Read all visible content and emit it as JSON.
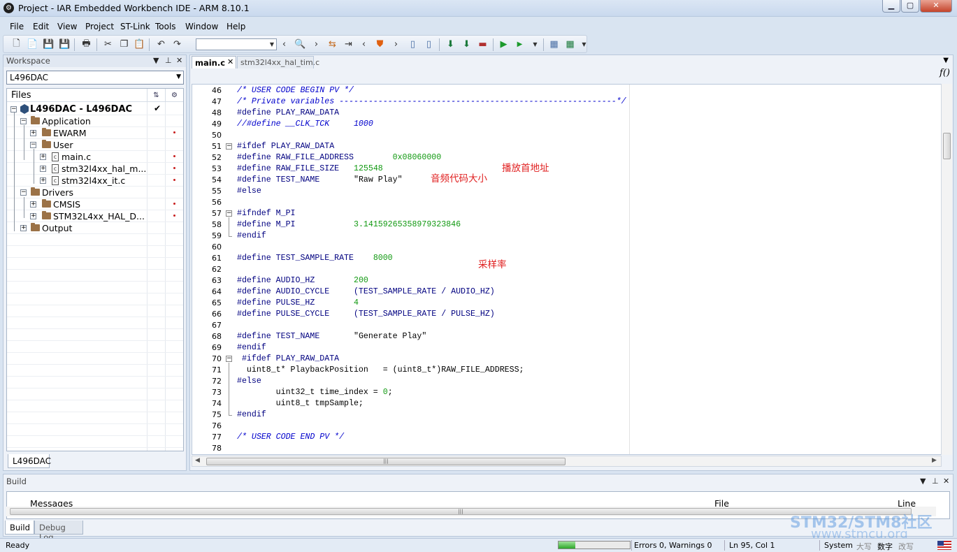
{
  "window": {
    "title": "Project - IAR Embedded Workbench IDE - ARM 8.10.1",
    "min": "▁",
    "max": "▢",
    "close": "✕"
  },
  "menu": [
    "File",
    "Edit",
    "View",
    "Project",
    "ST-Link",
    "Tools",
    "Window",
    "Help"
  ],
  "workspace": {
    "title": "Workspace",
    "config": "L496DAC",
    "files_header": "Files",
    "tab": "L496DAC",
    "tree": [
      {
        "label": "L496DAC - L496DAC",
        "bold": true,
        "check": "✔"
      },
      {
        "label": "Application"
      },
      {
        "label": "EWARM"
      },
      {
        "label": "User"
      },
      {
        "label": "main.c"
      },
      {
        "label": "stm32l4xx_hal_m..."
      },
      {
        "label": "stm32l4xx_it.c"
      },
      {
        "label": "Drivers"
      },
      {
        "label": "CMSIS"
      },
      {
        "label": "STM32L4xx_HAL_D..."
      },
      {
        "label": "Output"
      }
    ]
  },
  "editor": {
    "tabs": [
      {
        "label": "main.c",
        "active": true,
        "close": "✕"
      },
      {
        "label": "stm32l4xx_hal_tim.c",
        "active": false
      }
    ],
    "fn_label": "f()",
    "lines": [
      {
        "n": "46",
        "parts": [
          {
            "t": "/* USER CODE BEGIN PV */",
            "c": "com"
          }
        ]
      },
      {
        "n": "47",
        "parts": [
          {
            "t": "/* Private variables ---------------------------------------------------------*/",
            "c": "com"
          }
        ]
      },
      {
        "n": "48",
        "parts": [
          {
            "t": "#define PLAY_RAW_DATA",
            "c": "pre"
          }
        ]
      },
      {
        "n": "49",
        "parts": [
          {
            "t": "//#define __CLK_TCK     1000",
            "c": "com"
          }
        ]
      },
      {
        "n": "50",
        "parts": []
      },
      {
        "n": "51",
        "fold": "box",
        "parts": [
          {
            "t": "#ifdef PLAY_RAW_DATA",
            "c": "pre"
          }
        ]
      },
      {
        "n": "52",
        "parts": [
          {
            "t": "#define RAW_FILE_ADDRESS        ",
            "c": "pre"
          },
          {
            "t": "0x08060000",
            "c": "num"
          }
        ]
      },
      {
        "n": "53",
        "parts": [
          {
            "t": "#define RAW_FILE_SIZE   ",
            "c": "pre"
          },
          {
            "t": "125548",
            "c": "num"
          }
        ]
      },
      {
        "n": "54",
        "parts": [
          {
            "t": "#define TEST_NAME       ",
            "c": "pre"
          },
          {
            "t": "\"Raw Play\"",
            "c": "str"
          }
        ]
      },
      {
        "n": "55",
        "parts": [
          {
            "t": "#else",
            "c": "pre"
          }
        ]
      },
      {
        "n": "56",
        "parts": []
      },
      {
        "n": "57",
        "fold": "box",
        "parts": [
          {
            "t": "#ifndef M_PI",
            "c": "pre"
          }
        ]
      },
      {
        "n": "58",
        "parts": [
          {
            "t": "#define M_PI            ",
            "c": "pre"
          },
          {
            "t": "3.14159265358979323846",
            "c": "num"
          }
        ]
      },
      {
        "n": "59",
        "fold": "end",
        "parts": [
          {
            "t": "#endif",
            "c": "pre"
          }
        ]
      },
      {
        "n": "60",
        "parts": []
      },
      {
        "n": "61",
        "parts": [
          {
            "t": "#define TEST_SAMPLE_RATE    ",
            "c": "pre"
          },
          {
            "t": "8000",
            "c": "num"
          }
        ]
      },
      {
        "n": "62",
        "parts": []
      },
      {
        "n": "63",
        "parts": [
          {
            "t": "#define AUDIO_HZ        ",
            "c": "pre"
          },
          {
            "t": "200",
            "c": "num"
          }
        ]
      },
      {
        "n": "64",
        "parts": [
          {
            "t": "#define AUDIO_CYCLE     (TEST_SAMPLE_RATE / AUDIO_HZ)",
            "c": "pre"
          }
        ]
      },
      {
        "n": "65",
        "parts": [
          {
            "t": "#define PULSE_HZ        ",
            "c": "pre"
          },
          {
            "t": "4",
            "c": "num"
          }
        ]
      },
      {
        "n": "66",
        "parts": [
          {
            "t": "#define PULSE_CYCLE     (TEST_SAMPLE_RATE / PULSE_HZ)",
            "c": "pre"
          }
        ]
      },
      {
        "n": "67",
        "parts": []
      },
      {
        "n": "68",
        "parts": [
          {
            "t": "#define TEST_NAME       ",
            "c": "pre"
          },
          {
            "t": "\"Generate Play\"",
            "c": "str"
          }
        ]
      },
      {
        "n": "69",
        "fold": "end",
        "parts": [
          {
            "t": "#endif",
            "c": "pre"
          }
        ]
      },
      {
        "n": "70",
        "fold": "box",
        "parts": [
          {
            "t": " #ifdef PLAY_RAW_DATA",
            "c": "pre"
          }
        ]
      },
      {
        "n": "71",
        "parts": [
          {
            "t": "  uint8_t* PlaybackPosition   = (uint8_t*)RAW_FILE_ADDRESS;",
            "c": "str"
          }
        ]
      },
      {
        "n": "72",
        "parts": [
          {
            "t": "#else",
            "c": "pre"
          }
        ]
      },
      {
        "n": "73",
        "parts": [
          {
            "t": "        uint32_t time_index = ",
            "c": "str"
          },
          {
            "t": "0",
            "c": "num"
          },
          {
            "t": ";",
            "c": "str"
          }
        ]
      },
      {
        "n": "74",
        "parts": [
          {
            "t": "        uint8_t tmpSample;",
            "c": "str"
          }
        ]
      },
      {
        "n": "75",
        "fold": "end",
        "parts": [
          {
            "t": "#endif",
            "c": "pre"
          }
        ]
      },
      {
        "n": "76",
        "parts": []
      },
      {
        "n": "77",
        "parts": [
          {
            "t": "/* USER CODE END PV */",
            "c": "com"
          }
        ]
      },
      {
        "n": "78",
        "parts": []
      }
    ],
    "annotations": {
      "address": "播放首地址",
      "size": "音频代码大小",
      "rate": "采样率"
    }
  },
  "build": {
    "title": "Build",
    "col_messages": "Messages",
    "col_file": "File",
    "col_line": "Line",
    "tabs": [
      "Build",
      "Debug Log"
    ]
  },
  "status": {
    "ready": "Ready",
    "progress": 0.24,
    "errors": "Errors 0, Warnings 0",
    "position": "Ln 95, Col 1",
    "system": "System",
    "caps": "大写",
    "num": "数字",
    "ovr": "改写"
  },
  "watermark": {
    "line1": "STM32/STM8社区",
    "line2": "www.stmcu.org"
  }
}
